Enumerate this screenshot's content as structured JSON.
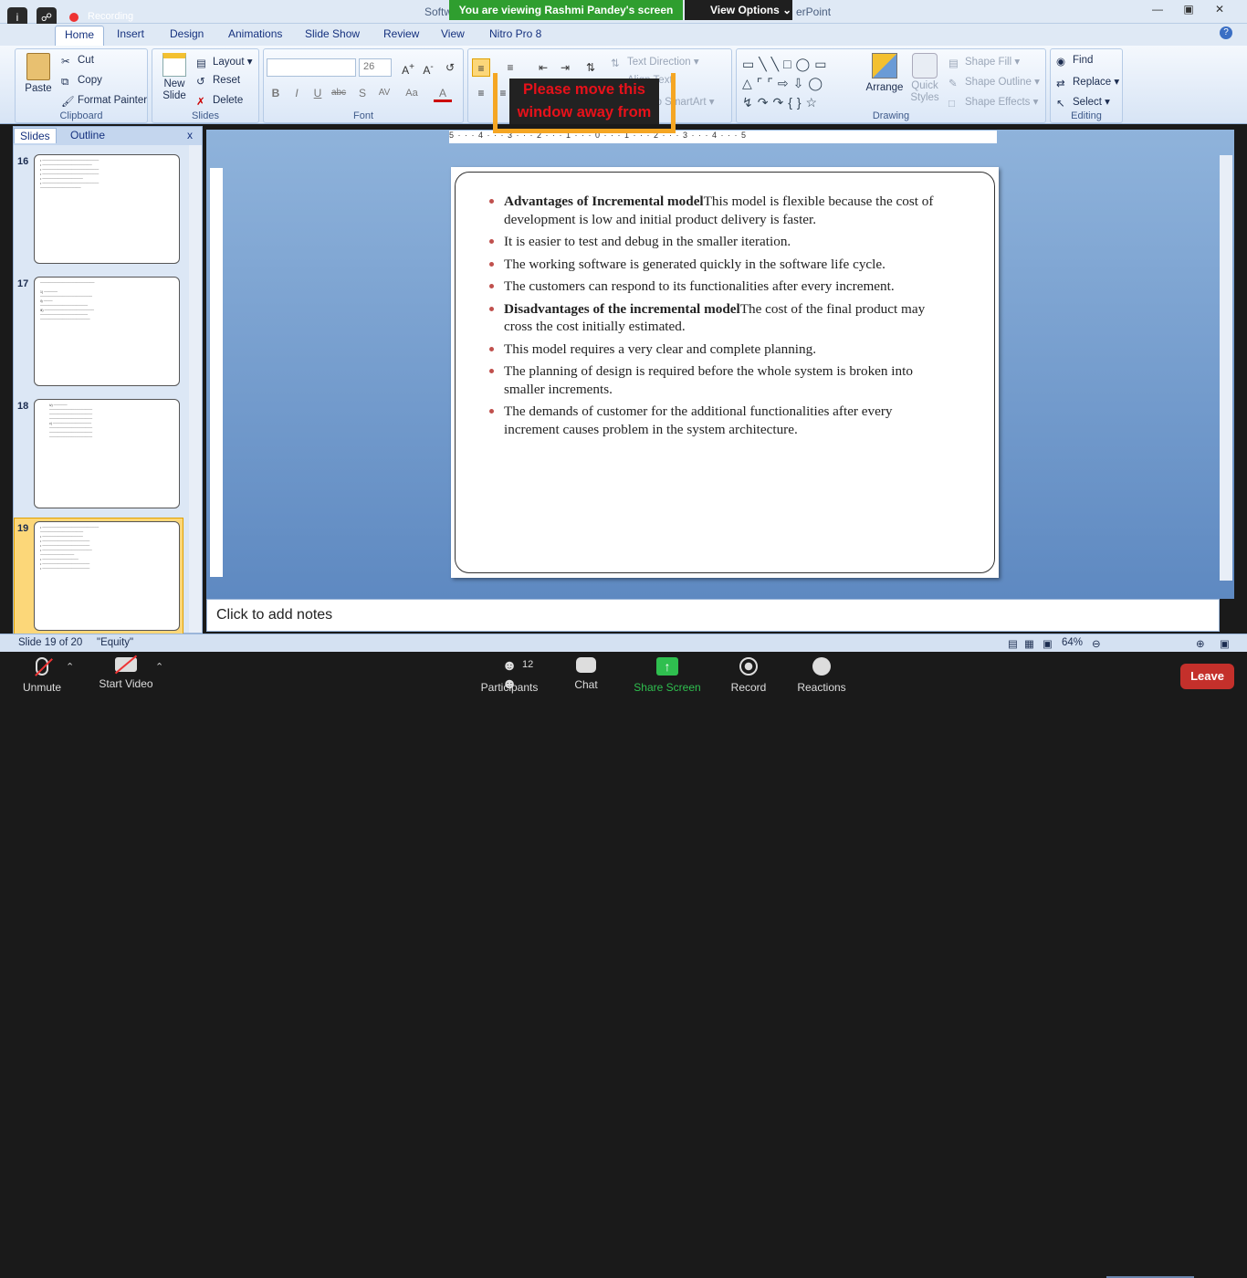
{
  "app": {
    "title_left": "Softw",
    "title_right": "erPoint"
  },
  "zoom_banner": {
    "viewing": "You are viewing Rashmi Pandey's screen",
    "view_options": "View Options",
    "recording_label": "Recording"
  },
  "tabs": [
    "Home",
    "Insert",
    "Design",
    "Animations",
    "Slide Show",
    "Review",
    "View",
    "Nitro Pro 8"
  ],
  "ribbon": {
    "clipboard": {
      "label": "Clipboard",
      "paste": "Paste",
      "cut": "Cut",
      "copy": "Copy",
      "format_painter": "Format Painter"
    },
    "slides": {
      "label": "Slides",
      "new_slide": "New Slide",
      "layout": "Layout",
      "reset": "Reset",
      "delete": "Delete"
    },
    "font": {
      "label": "Font",
      "size": "26"
    },
    "paragraph": {
      "text_direction": "Text Direction",
      "align_text": "Align Text",
      "smartart": "t to SmartArt"
    },
    "drawing": {
      "label": "Drawing",
      "arrange": "Arrange",
      "quick_styles": "Quick Styles",
      "shape_fill": "Shape Fill",
      "shape_outline": "Shape Outline",
      "shape_effects": "Shape Effects"
    },
    "editing": {
      "label": "Editing",
      "find": "Find",
      "replace": "Replace",
      "select": "Select"
    }
  },
  "annotation": {
    "line1": "Please move this",
    "line2": "window away from"
  },
  "left_panel": {
    "tab_slides": "Slides",
    "tab_outline": "Outline",
    "close": "x",
    "slide_numbers": [
      "16",
      "17",
      "18",
      "19"
    ]
  },
  "ruler": {
    "h": "5 · · · 4 · · · 3 · · · 2 · · · 1 · · · 0 · · · 1 · · · 2 · · · 3 · · · 4 · · · 5"
  },
  "slide": {
    "bullets": [
      {
        "bold": "Advantages of Incremental model",
        "text": "This model is flexible because the cost of development is low and initial product delivery is faster."
      },
      {
        "bold": "",
        "text": "It is easier to test and debug in the smaller iteration."
      },
      {
        "bold": "",
        "text": "The working software is generated quickly in the software life cycle."
      },
      {
        "bold": "",
        "text": "The customers can respond to its functionalities after every increment."
      },
      {
        "bold": "Disadvantages of the incremental model",
        "text": "The cost of the final product may cross the cost initially estimated."
      },
      {
        "bold": "",
        "text": "This model requires a very clear and complete planning."
      },
      {
        "bold": "",
        "text": "The planning of design is required before the whole system is broken into smaller increments."
      },
      {
        "bold": "",
        "text": "The demands of customer for the additional functionalities after every increment causes problem in the system architecture."
      }
    ]
  },
  "notes": {
    "placeholder": "Click to add notes"
  },
  "status": {
    "slide": "Slide 19 of 20",
    "theme": "\"Equity\"",
    "zoom": "64%"
  },
  "zoom_bar": {
    "unmute": "Unmute",
    "start_video": "Start Video",
    "participants": "Participants",
    "participant_count": "12",
    "chat": "Chat",
    "share_screen": "Share Screen",
    "record": "Record",
    "reactions": "Reactions",
    "leave": "Leave"
  },
  "colors": {
    "share_green": "#2fbf4f",
    "leave_red": "#c4302b",
    "banner_green": "#2f9e2f",
    "annotation_orange": "#f5a623",
    "annotation_red": "#e8111a",
    "bullet": "#c0504d"
  }
}
